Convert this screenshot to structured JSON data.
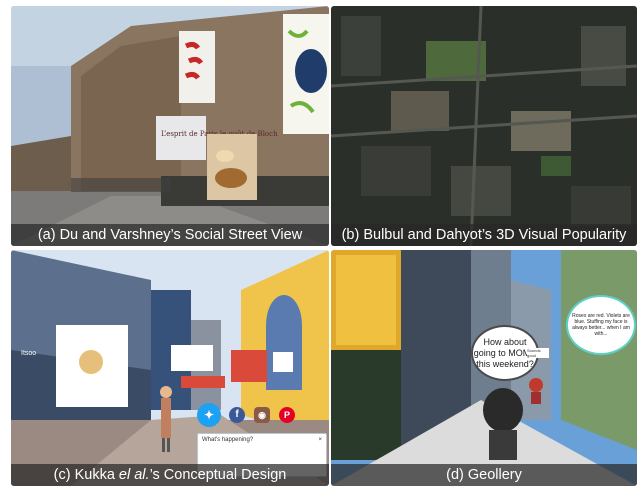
{
  "panels": [
    {
      "id": "a",
      "caption_prefix": "(a) Du and Varshney’s Social Street View",
      "billboard_text": "L’esprit de Paris le goût de Bloch"
    },
    {
      "id": "b",
      "caption_prefix": "(b) Bulbul and Dahyot’s 3D Visual Popularity"
    },
    {
      "id": "c",
      "caption_lead": "(c) Kukka ",
      "caption_italic": "el al.",
      "caption_tail": "’s Conceptual Design",
      "compose_prompt": "What's happening?",
      "compose_close": "×",
      "store_sign": "Itsoo"
    },
    {
      "id": "d",
      "caption_prefix": "(d) Geollery",
      "bubble_main": "How about going to MOMA this weekend?",
      "bubble_poem": "Roses are red. Violets are blue. Stuffing my face is always better... when I am with...",
      "small_label": "Sounds good"
    }
  ],
  "colors": {
    "caption_bg": "#282828",
    "twitter": "#1da1f2",
    "facebook": "#3b5998",
    "instagram": "#8a5a44",
    "pinterest": "#e60023"
  }
}
